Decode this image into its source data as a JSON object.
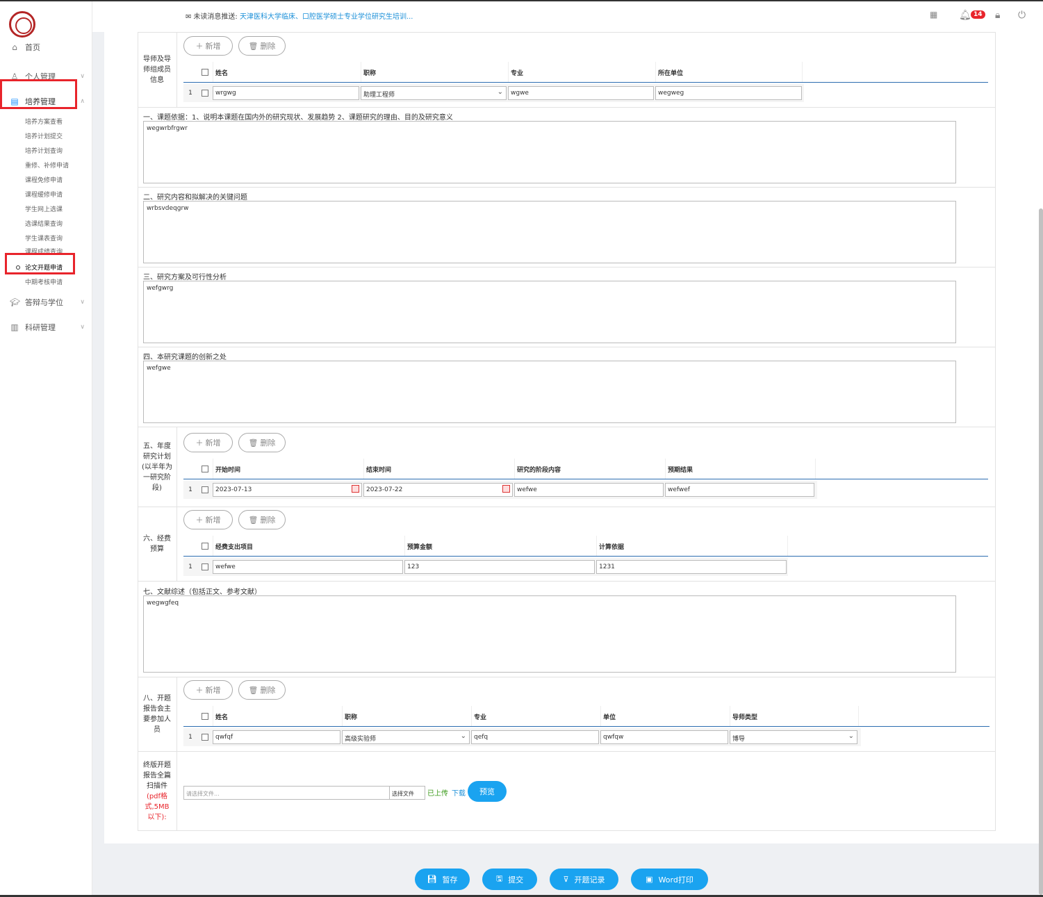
{
  "sidebar": {
    "home": "首页",
    "personal": "个人管理",
    "training": "培养管理",
    "training_items": [
      "培养方案查看",
      "培养计划提交",
      "培养计划查询",
      "重修、补修申请",
      "课程免修申请",
      "课程缓修申请",
      "学生网上选课",
      "选课结果查询",
      "学生课表查询",
      "课程成绩查询",
      "论文开题申请",
      "中期考核申请"
    ],
    "defense": "答辩与学位",
    "research": "科研管理"
  },
  "topbar": {
    "msg_label": "未读消息推送:",
    "msg_text": "天津医科大学临床、口腔医学硕士专业学位研究生培训...",
    "badge": "14"
  },
  "buttons": {
    "add": "新增",
    "delete": "删除"
  },
  "advisors": {
    "label": "导师及导师组成员信息",
    "headers": [
      "姓名",
      "职称",
      "专业",
      "所在单位"
    ],
    "row": {
      "n": "1",
      "name": "wrgwg",
      "title": "助理工程师",
      "major": "wgwe",
      "unit": "wegweg"
    }
  },
  "sec1": {
    "title": "一、课题依据：1、说明本课题在国内外的研究现状、发展趋势 2、课题研究的理由、目的及研究意义",
    "value": "wegwrbfrgwr"
  },
  "sec2": {
    "title": "二、研究内容和拟解决的关键问题",
    "value": "wrbsvdeqgrw"
  },
  "sec3": {
    "title": "三、研究方案及可行性分析",
    "value": "wefgwrg"
  },
  "sec4": {
    "title": "四、本研究课题的创新之处",
    "value": "wefgwe"
  },
  "plan": {
    "label": "五、年度研究计划(以半年为一研究阶段)",
    "headers": [
      "开始时间",
      "结束时间",
      "研究的阶段内容",
      "预期结果"
    ],
    "row": {
      "n": "1",
      "start": "2023-07-13",
      "end": "2023-07-22",
      "content": "wefwe",
      "result": "wefwef"
    }
  },
  "budget": {
    "label": "六、经费预算",
    "headers": [
      "经费支出项目",
      "预算金额",
      "计算依据"
    ],
    "row": {
      "n": "1",
      "item": "wefwe",
      "amount": "123",
      "basis": "1231"
    }
  },
  "sec7": {
    "title": "七、文献综述（包括正文、参考文献）",
    "value": "wegwgfeq"
  },
  "participants": {
    "label": "八、开题报告会主要参加人员",
    "headers": [
      "姓名",
      "职称",
      "专业",
      "单位",
      "导师类型"
    ],
    "row": {
      "n": "1",
      "name": "qwfqf",
      "title": "高级实验师",
      "major": "qefq",
      "unit": "qwfqw",
      "type": "博导"
    }
  },
  "upload": {
    "label_a": "终版开题报告全篇扫描件",
    "label_b": "(pdf格式,5MB以下):",
    "placeholder": "请选择文件...",
    "choose": "选择文件",
    "uploaded": "已上传",
    "download": "下载",
    "preview": "预览"
  },
  "footer": {
    "save": "暂存",
    "submit": "提交",
    "records": "开题记录",
    "word": "Word打印"
  },
  "colors": {
    "accent": "#1aa3f0",
    "highlight": "#e8242b",
    "link": "#1a8fd8"
  },
  "icons": [
    "home-icon",
    "user-icon",
    "book-icon",
    "graduation-icon",
    "chart-icon",
    "calendar-icon",
    "bell-icon",
    "lock-icon",
    "power-icon",
    "envelope-icon"
  ]
}
